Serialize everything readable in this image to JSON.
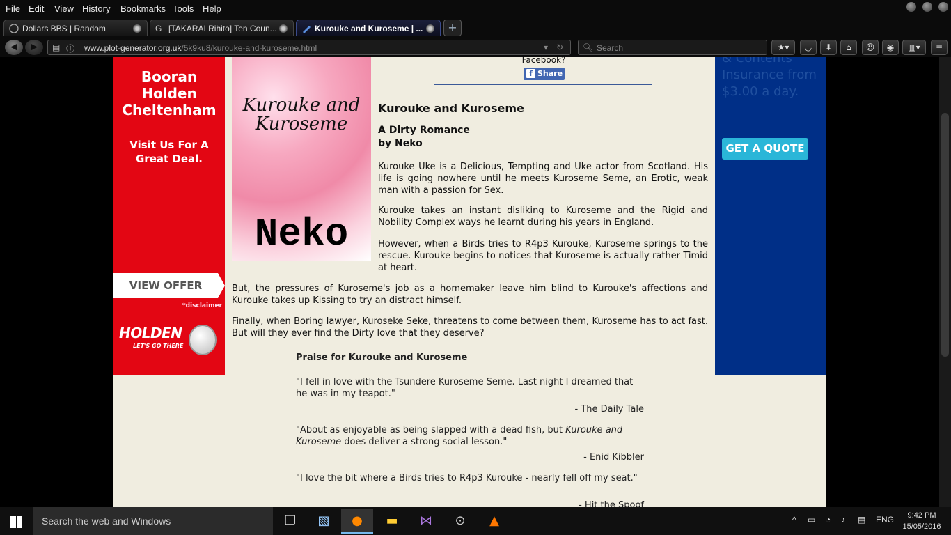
{
  "menu": [
    "File",
    "Edit",
    "View",
    "History",
    "Bookmarks",
    "Tools",
    "Help"
  ],
  "tabs": [
    {
      "label": "Dollars BBS | Random",
      "icon": "globe-icon"
    },
    {
      "label": "[TAKARAI Rihito] Ten Coun...",
      "icon": "g-letter-icon"
    },
    {
      "label": "Kurouke and Kuroseme | ...",
      "icon": "pen-icon"
    }
  ],
  "url": {
    "domain": "www.plot-generator.org.uk",
    "path": "/5k9ku8/kurouke-and-kuroseme.html"
  },
  "search_placeholder": "Search",
  "ad_left": {
    "heading": "Booran Holden Cheltenham",
    "subheading": "Visit Us For A Great Deal.",
    "cta": "VIEW OFFER",
    "disclaimer": "*disclaimer",
    "brand": "HOLDEN",
    "tagline": "LET'S GO THERE"
  },
  "cover": {
    "title": "Kurouke and Kuroseme",
    "author": "Neko"
  },
  "facebook": {
    "prompt": "Facebook?",
    "share_label": "Share"
  },
  "book": {
    "title": "Kurouke and Kuroseme",
    "subtitle": "A Dirty Romance",
    "byline": "by Neko",
    "paragraphs": [
      "Kurouke Uke is a Delicious, Tempting and Uke actor from Scotland. His life is going nowhere until he meets Kuroseme Seme, an Erotic, weak man with a passion for Sex.",
      "Kurouke takes an instant disliking to Kuroseme and the Rigid and Nobility Complex ways he learnt during his years in England.",
      "However, when a Birds tries to R4p3 Kurouke, Kuroseme springs to the rescue. Kurouke begins to notices that Kuroseme is actually rather Timid at heart.",
      "But, the pressures of Kuroseme's job as a homemaker leave him blind to Kurouke's affections and Kurouke takes up Kissing to try an distract himself.",
      "Finally, when Boring lawyer, Kuroseke Seke, threatens to come between them, Kuroseme has to act fast. But will they ever find the Dirty love that they deserve?"
    ]
  },
  "praise": {
    "heading": "Praise for Kurouke and Kuroseme",
    "quotes": [
      {
        "text_before": "\"I fell in love with the Tsundere Kuroseme Seme. Last night I dreamed that he was in my teapot.\"",
        "italic": "",
        "text_after": "",
        "source": "- The Daily Tale"
      },
      {
        "text_before": "\"About as enjoyable as being slapped with a dead fish, but ",
        "italic": "Kurouke and Kuroseme",
        "text_after": " does deliver a strong social lesson.\"",
        "source": "- Enid Kibbler"
      },
      {
        "text_before": "\"I love the bit where a Birds tries to R4p3 Kurouke - nearly fell off my seat.\"",
        "italic": "",
        "text_after": "",
        "source": "- Hit the Spoof"
      }
    ]
  },
  "ad_right": {
    "text": "& Contents Insurance from $3.00 a day.",
    "cta": "GET A QUOTE"
  },
  "taskbar": {
    "search_placeholder": "Search the web and Windows",
    "language": "ENG",
    "time": "9:42 PM",
    "date": "15/05/2016"
  },
  "colors": {
    "ad_left_bg": "#e30613",
    "ad_right_bg": "#002f87",
    "page_bg": "#f0ede0",
    "quote_button": "#2ab6d8",
    "fb_blue": "#4267b2"
  }
}
